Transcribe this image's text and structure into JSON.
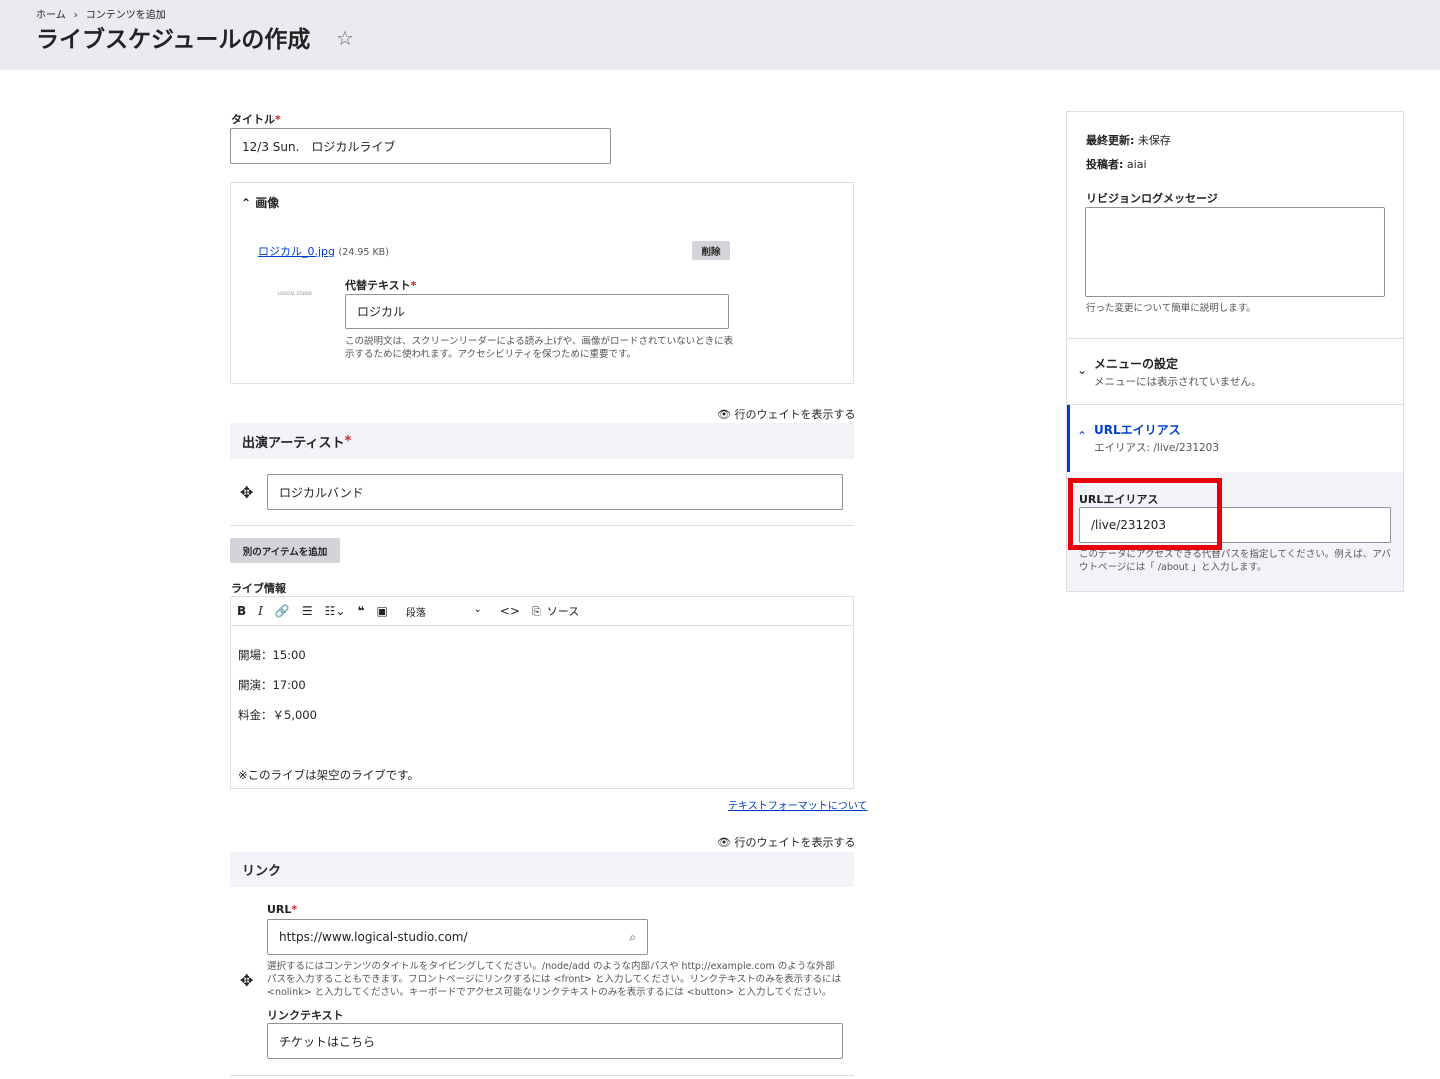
{
  "breadcrumb": {
    "home": "ホーム",
    "sep": "›",
    "current": "コンテンツを追加"
  },
  "page_title": "ライブスケジュールの作成",
  "star": "☆",
  "title_field": {
    "label": "タイトル",
    "required": "*",
    "value": "12/3 Sun.　ロジカルライブ"
  },
  "image": {
    "section": "画像",
    "file_link": "ロジカル_0.jpg",
    "file_size": "(24.95 KB)",
    "delete": "削除",
    "alt_label": "代替テキスト",
    "alt_value": "ロジカル",
    "alt_help": "この説明文は、スクリーンリーダーによる読み上げや、画像がロードされていないときに表示するために使われます。アクセシビリティを保つために重要です。",
    "thumb_text": "LOGICAL STUDIO"
  },
  "show_weights": "行のウェイトを表示する",
  "artist": {
    "label": "出演アーティスト",
    "value": "ロジカルバンド",
    "add": "別のアイテムを追加"
  },
  "live_info": {
    "label": "ライブ情報",
    "paragraph": "段落",
    "source": "ソース",
    "lines": [
      "開場：15:00",
      "開演：17:00",
      "料金：￥5,000",
      "※このライブは架空のライブです。"
    ],
    "format_link": "テキストフォーマットについて"
  },
  "link": {
    "section": "リンク",
    "url_label": "URL",
    "url_value": "https://www.logical-studio.com/",
    "url_help": "選択するにはコンテンツのタイトルをタイピングしてください。/node/add のような内部パスや http://example.com のような外部パスを入力することもできます。フロントページにリンクするには <front> と入力してください。リンクテキストのみを表示するには <nolink> と入力してください。キーボードでアクセス可能なリンクテキストのみを表示するには <button> と入力してください。",
    "text_label": "リンクテキスト",
    "text_value": "チケットはこちら"
  },
  "sidebar": {
    "updated_label": "最終更新:",
    "updated_value": "未保存",
    "author_label": "投稿者:",
    "author_value": "aiai",
    "revision_label": "リビジョンログメッセージ",
    "revision_help": "行った変更について簡単に説明します。",
    "menu_title": "メニューの設定",
    "menu_summary": "メニューには表示されていません。",
    "alias_title": "URLエイリアス",
    "alias_summary": "エイリアス: /live/231203",
    "alias_label": "URLエイリアス",
    "alias_value": "/live/231203",
    "alias_help": "このデータにアクセスできる代替パスを指定してください。例えば、アバウトページには「 /about 」と入力します。"
  },
  "colors": {
    "highlight": "#e8000b",
    "link": "#003ecc"
  }
}
